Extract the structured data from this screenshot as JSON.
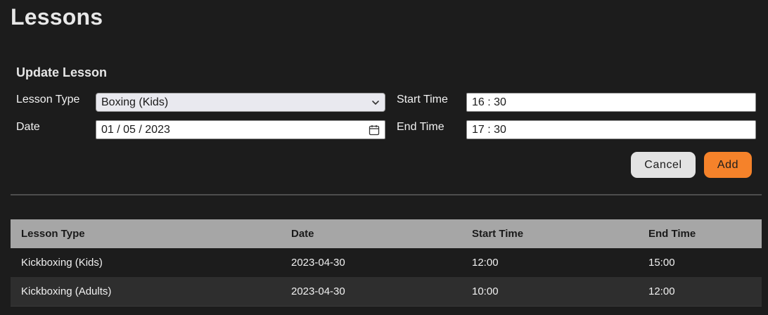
{
  "page": {
    "title": "Lessons"
  },
  "form": {
    "title": "Update Lesson",
    "lesson_type": {
      "label": "Lesson Type",
      "value": "Boxing (Kids)",
      "icon": "chevron-down-icon"
    },
    "date": {
      "label": "Date",
      "value": "01 / 05 / 2023",
      "icon": "calendar-icon"
    },
    "start_time": {
      "label": "Start Time",
      "value": "16 : 30"
    },
    "end_time": {
      "label": "End Time",
      "value": "17 : 30"
    },
    "cancel_label": "Cancel",
    "add_label": "Add"
  },
  "table": {
    "columns": [
      "Lesson Type",
      "Date",
      "Start Time",
      "End Time"
    ],
    "rows": [
      [
        "Kickboxing (Kids)",
        "2023-04-30",
        "12:00",
        "15:00"
      ],
      [
        "Kickboxing (Adults)",
        "2023-04-30",
        "10:00",
        "12:00"
      ]
    ]
  },
  "colors": {
    "background": "#1c1c1c",
    "accent": "#f5822a",
    "header_bg": "#a6a6a6",
    "alt_row": "#2e2e2e"
  }
}
